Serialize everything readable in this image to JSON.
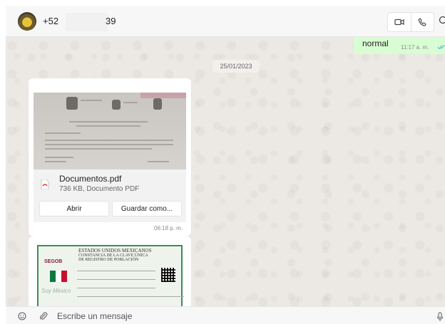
{
  "header": {
    "contact_prefix": "+52",
    "contact_suffix": "39",
    "video_call_icon": "video-camera-icon",
    "voice_call_icon": "phone-icon",
    "search_icon": "search-icon"
  },
  "messages": {
    "outgoing": {
      "text": "normal",
      "time": "11:17 a. m.",
      "status_icon": "double-check-icon"
    },
    "date_separator": "25/01/2023",
    "document": {
      "file_name": "Documentos.pdf",
      "meta": "736 KB, Documento PDF",
      "open_label": "Abrir",
      "save_label": "Guardar como...",
      "time": "06:18 p. m."
    },
    "image_card": {
      "header_line1": "ESTADOS UNIDOS MEXICANOS",
      "header_line2": "CONSTANCIA DE LA CLAVE ÚNICA",
      "header_line3": "DE REGISTRO DE POBLACIÓN",
      "agency": "SEGOB",
      "slogan": "Soy México"
    }
  },
  "composer": {
    "placeholder": "Escribe un mensaje",
    "emoji_icon": "emoji-icon",
    "attach_icon": "paperclip-icon",
    "mic_icon": "microphone-icon"
  },
  "colors": {
    "outgoing_bubble": "#d9fdd3",
    "chat_background": "#ece8e3",
    "read_tick": "#53bdeb",
    "document_border": "#3f8b57"
  }
}
